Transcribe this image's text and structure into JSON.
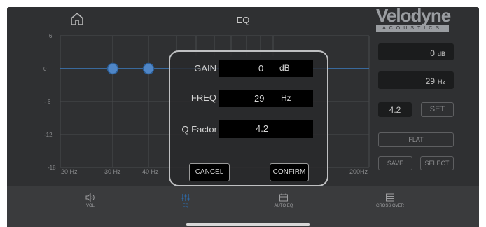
{
  "header": {
    "title": "EQ",
    "logo_word": "Velodyne",
    "logo_sub": "ACOUSTICS"
  },
  "graph": {
    "y_ticks": [
      "+ 6",
      "0",
      "- 6",
      "-12",
      "-18"
    ],
    "x_ticks": [
      "20 Hz",
      "30 Hz",
      "40 Hz",
      "200Hz"
    ],
    "line_color": "#3d7cc0"
  },
  "side": {
    "gain_value": "0",
    "gain_unit": "dB",
    "freq_value": "29",
    "freq_unit": "Hz",
    "q_value": "4.2",
    "set_label": "SET",
    "flat_label": "FLAT",
    "save_label": "SAVE",
    "select_label": "SELECT"
  },
  "dialog": {
    "gain_label": "GAIN",
    "gain_value": "0",
    "gain_unit": "dB",
    "freq_label": "FREQ",
    "freq_value": "29",
    "freq_unit": "Hz",
    "q_label": "Q Factor",
    "q_value": "4.2",
    "cancel_label": "CANCEL",
    "confirm_label": "CONFIRM"
  },
  "tabs": [
    {
      "label": "VOL",
      "icon": "speaker-icon"
    },
    {
      "label": "EQ",
      "icon": "sliders-icon",
      "active": true
    },
    {
      "label": "AUTO EQ",
      "icon": "auto-eq-icon"
    },
    {
      "label": "CROSS OVER",
      "icon": "crossover-icon"
    }
  ],
  "colors": {
    "accent": "#2c6fb3",
    "background": "#2f3032"
  }
}
